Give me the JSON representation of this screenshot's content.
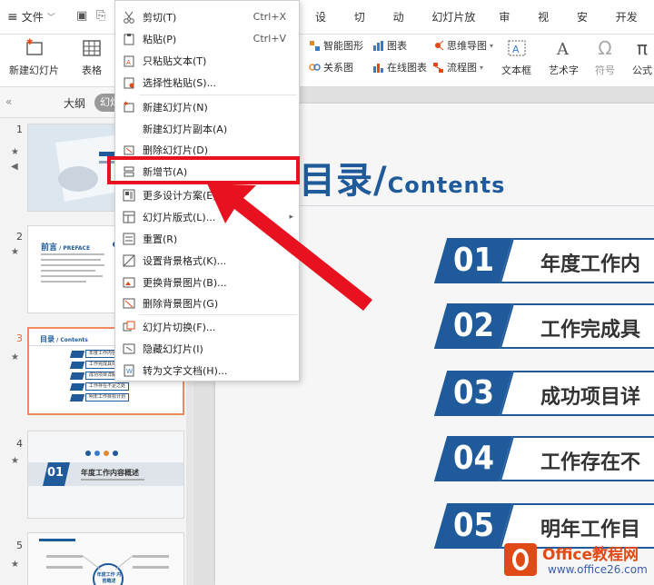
{
  "menubar": {
    "file_label": "文件",
    "tabs": [
      "设计",
      "切换",
      "动画",
      "幻灯片放映",
      "审阅",
      "视图",
      "安全",
      "开发工"
    ]
  },
  "ribbon": {
    "new_slide": "新建幻灯片",
    "table": "表格",
    "smart_art": "智能图形",
    "chart": "图表",
    "mind_map": "思维导图",
    "relation": "关系图",
    "online_chart": "在线图表",
    "flow_chart": "流程图",
    "textbox": "文本框",
    "art_text": "艺术字",
    "symbol": "符号",
    "formula": "公式"
  },
  "left_pane": {
    "tab_outline": "大纲",
    "tab_slides": "幻灯",
    "slide_numbers": [
      "1",
      "2",
      "3",
      "4",
      "5"
    ],
    "thumb2_title": "前言",
    "thumb2_sub": "PREFACE",
    "thumb3_title": "目录",
    "thumb3_sub": "Contents",
    "thumb3_items": [
      "年度工作内容概述",
      "工作完成具体情况",
      "成功项目详解",
      "工作存在不足之处",
      "明年工作目标计划"
    ],
    "thumb4_num": "01",
    "thumb4_title": "年度工作内容概述",
    "thumb5_center": "年度工作 内容概述"
  },
  "context_menu": {
    "items": [
      {
        "label": "剪切(T)",
        "shortcut": "Ctrl+X"
      },
      {
        "label": "粘贴(P)",
        "shortcut": "Ctrl+V"
      },
      {
        "label": "只粘贴文本(T)",
        "shortcut": ""
      },
      {
        "label": "选择性粘贴(S)...",
        "shortcut": ""
      },
      {
        "label": "新建幻灯片(N)",
        "shortcut": ""
      },
      {
        "label": "新建幻灯片副本(A)",
        "shortcut": ""
      },
      {
        "label": "删除幻灯片(D)",
        "shortcut": ""
      },
      {
        "label": "新增节(A)",
        "shortcut": ""
      },
      {
        "label": "更多设计方案(E)...",
        "shortcut": ""
      },
      {
        "label": "幻灯片版式(L)...",
        "shortcut": ""
      },
      {
        "label": "重置(R)",
        "shortcut": ""
      },
      {
        "label": "设置背景格式(K)...",
        "shortcut": ""
      },
      {
        "label": "更换背景图片(B)...",
        "shortcut": ""
      },
      {
        "label": "删除背景图片(G)",
        "shortcut": ""
      },
      {
        "label": "幻灯片切换(F)...",
        "shortcut": ""
      },
      {
        "label": "隐藏幻灯片(I)",
        "shortcut": ""
      },
      {
        "label": "转为文字文档(H)...",
        "shortcut": ""
      }
    ],
    "highlighted": "新增节(A)"
  },
  "slide": {
    "title_cn": "目录/",
    "title_en": "Contents",
    "items": [
      {
        "num": "01",
        "text": "年度工作内"
      },
      {
        "num": "02",
        "text": "工作完成具"
      },
      {
        "num": "03",
        "text": "成功项目详"
      },
      {
        "num": "04",
        "text": "工作存在不"
      },
      {
        "num": "05",
        "text": "明年工作目"
      }
    ]
  },
  "watermark": {
    "title": "Office教程网",
    "url": "www.office26.com"
  },
  "colors": {
    "accent": "#1f5a9a",
    "highlight": "#e8111f",
    "active_thumb": "#ef8a5d"
  }
}
